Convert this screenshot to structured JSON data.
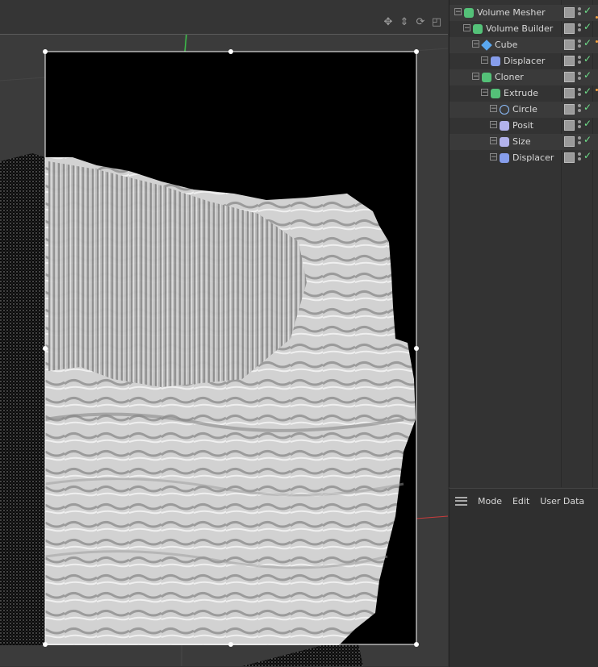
{
  "viewport": {
    "toolbar_icons": [
      "move-view-icon",
      "dolly-view-icon",
      "rotate-view-icon",
      "maximize-view-icon"
    ]
  },
  "object_manager": {
    "objects": [
      {
        "label": "Volume Mesher",
        "icon": "volume-mesher-icon",
        "depth": 0,
        "enabled": true
      },
      {
        "label": "Volume Builder",
        "icon": "volume-builder-icon",
        "depth": 1,
        "enabled": true
      },
      {
        "label": "Cube",
        "icon": "cube-icon",
        "depth": 2,
        "enabled": true
      },
      {
        "label": "Displacer",
        "icon": "displacer-icon",
        "depth": 3,
        "enabled": true
      },
      {
        "label": "Cloner",
        "icon": "cloner-icon",
        "depth": 2,
        "enabled": true
      },
      {
        "label": "Extrude",
        "icon": "extrude-icon",
        "depth": 3,
        "enabled": true
      },
      {
        "label": "Circle",
        "icon": "circle-spline-icon",
        "depth": 4,
        "enabled": true
      },
      {
        "label": "Posit",
        "icon": "effector-icon",
        "depth": 4,
        "enabled": true
      },
      {
        "label": "Size",
        "icon": "effector-icon",
        "depth": 4,
        "enabled": true
      },
      {
        "label": "Displacer",
        "icon": "displacer-icon",
        "depth": 4,
        "enabled": true
      }
    ]
  },
  "attribute_manager": {
    "menu": [
      "Mode",
      "Edit",
      "User Data"
    ]
  },
  "colors": {
    "viewport_bg": "#3b3b3b",
    "render_region_bg": "#000000",
    "mesh": "#d6d6d6",
    "check": "#6fe08a",
    "cube_icon": "#5aa8f0",
    "mesher_icon": "#58d080"
  }
}
